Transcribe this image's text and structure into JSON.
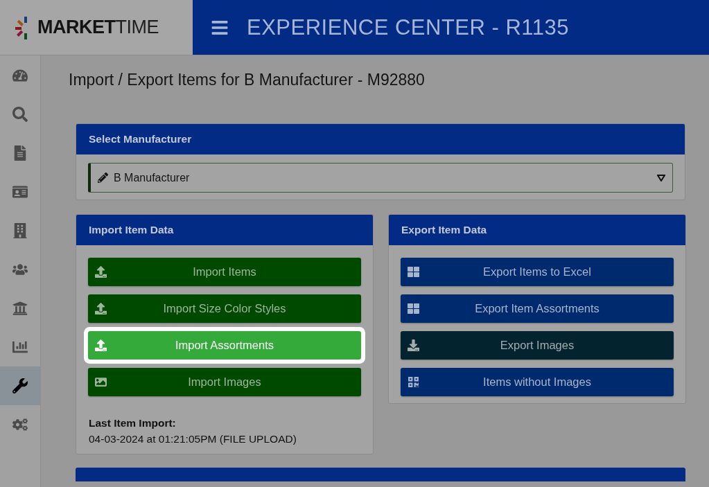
{
  "header": {
    "logo_text_bold": "MARKET",
    "logo_text_light": "TIME",
    "title": "EXPERIENCE CENTER - R1135"
  },
  "sidebar": {
    "items": [
      {
        "kind": "dashboard",
        "selected": false
      },
      {
        "kind": "search",
        "selected": false
      },
      {
        "kind": "document",
        "selected": false
      },
      {
        "kind": "contact",
        "selected": false
      },
      {
        "kind": "building",
        "selected": false
      },
      {
        "kind": "users",
        "selected": false
      },
      {
        "kind": "bank",
        "selected": false
      },
      {
        "kind": "chart",
        "selected": false
      },
      {
        "kind": "wrench",
        "selected": true
      },
      {
        "kind": "settings",
        "selected": false
      }
    ]
  },
  "page_title": "Import / Export Items for B Manufacturer - M92880",
  "select_panel": {
    "title": "Select Manufacturer",
    "value": "B Manufacturer"
  },
  "import_panel": {
    "title": "Import Item Data",
    "buttons": [
      {
        "label": "Import Items",
        "kind": "green",
        "highlighted": false
      },
      {
        "label": "Import Size Color Styles",
        "kind": "green",
        "highlighted": false
      },
      {
        "label": "Import Assortments",
        "kind": "green",
        "highlighted": true
      },
      {
        "label": "Import Images",
        "kind": "green",
        "highlighted": false
      }
    ],
    "last_import_label": "Last Item Import:",
    "last_import_value": "04-03-2024 at 01:21:05PM (FILE UPLOAD)"
  },
  "export_panel": {
    "title": "Export Item Data",
    "buttons": [
      {
        "label": "Export Items to Excel",
        "kind": "blue",
        "highlighted": false
      },
      {
        "label": "Export Item Assortments",
        "kind": "blue",
        "highlighted": false
      },
      {
        "label": "Export Images",
        "kind": "dark",
        "highlighted": false
      },
      {
        "label": "Items without Images",
        "kind": "blue",
        "highlighted": false
      }
    ]
  }
}
